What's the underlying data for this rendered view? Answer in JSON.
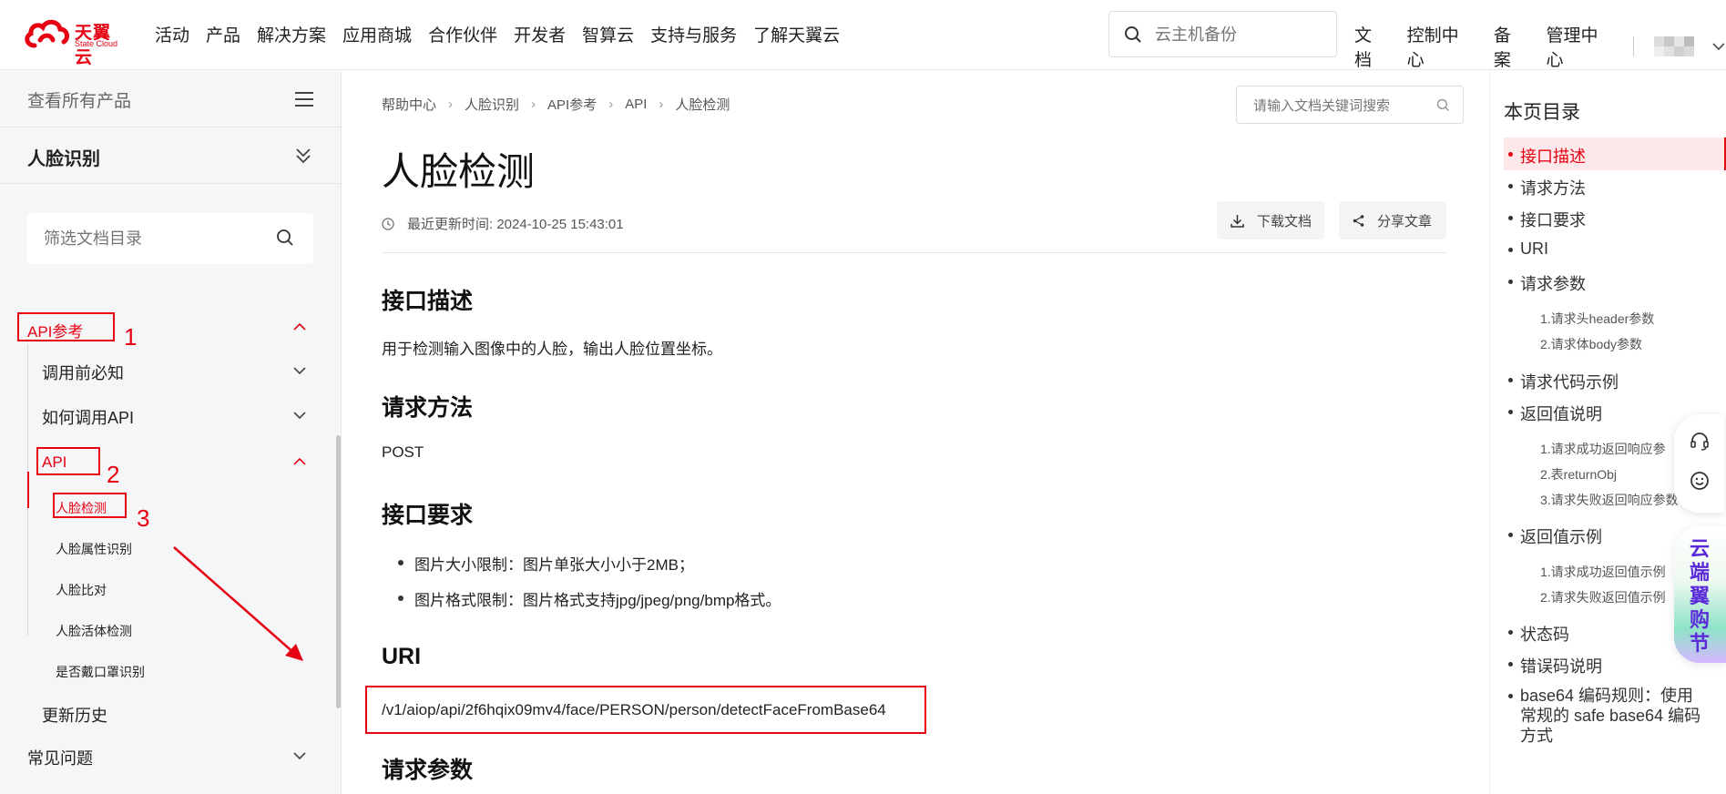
{
  "header": {
    "logo_cn": "天翼云",
    "logo_en": "State Cloud",
    "nav": [
      "活动",
      "产品",
      "解决方案",
      "应用商城",
      "合作伙伴",
      "开发者",
      "智算云",
      "支持与服务",
      "了解天翼云"
    ],
    "search_placeholder": "云主机备份",
    "right_links": [
      "文档",
      "控制中心",
      "备案",
      "管理中心"
    ]
  },
  "sidebar": {
    "all_products": "查看所有产品",
    "product_title": "人脸识别",
    "filter_placeholder": "筛选文档目录",
    "tree": {
      "api_ref": "API参考",
      "before_use": "调用前必知",
      "how_to_call": "如何调用API",
      "api": "API",
      "face_detect": "人脸检测",
      "face_attr": "人脸属性识别",
      "face_compare": "人脸比对",
      "face_liveness": "人脸活体检测",
      "mask_detect": "是否戴口罩识别",
      "update_history": "更新历史",
      "faq": "常见问题"
    },
    "annotations": [
      "1",
      "2",
      "3"
    ]
  },
  "main": {
    "breadcrumb": [
      "帮助中心",
      "人脸识别",
      "API参考",
      "API",
      "人脸检测"
    ],
    "doc_search_placeholder": "请输入文档关键词搜索",
    "title": "人脸检测",
    "updated": "最近更新时间: 2024-10-25 15:43:01",
    "download_label": "下载文档",
    "share_label": "分享文章",
    "sections": {
      "desc_h": "接口描述",
      "desc_p": "用于检测输入图像中的人脸，输出人脸位置坐标。",
      "method_h": "请求方法",
      "method_p": "POST",
      "req_h": "接口要求",
      "req_items": [
        "图片大小限制：图片单张大小小于2MB；",
        "图片格式限制：图片格式支持jpg/jpeg/png/bmp格式。"
      ],
      "uri_h": "URI",
      "uri_p": "/v1/aiop/api/2f6hqix09mv4/face/PERSON/person/detectFaceFromBase64",
      "params_h": "请求参数"
    }
  },
  "toc": {
    "title": "本页目录",
    "items": {
      "desc": "接口描述",
      "method": "请求方法",
      "req": "接口要求",
      "uri": "URI",
      "params": "请求参数",
      "params_sub1": "1.请求头header参数",
      "params_sub2": "2.请求体body参数",
      "code": "请求代码示例",
      "ret": "返回值说明",
      "ret_sub1": "1.请求成功返回响应参",
      "ret_sub2": "2.表returnObj",
      "ret_sub3": "3.请求失败返回响应参数",
      "ret_ex": "返回值示例",
      "ret_ex_sub1": "1.请求成功返回值示例",
      "ret_ex_sub2": "2.请求失败返回值示例",
      "status": "状态码",
      "err": "错误码说明",
      "b64": "base64 编码规则：使用常规的 safe base64 编码方式"
    }
  },
  "promo": {
    "text": "云端翼购节"
  },
  "colors": {
    "brand": "#e60012",
    "promo_text": "#5b2bd9"
  }
}
